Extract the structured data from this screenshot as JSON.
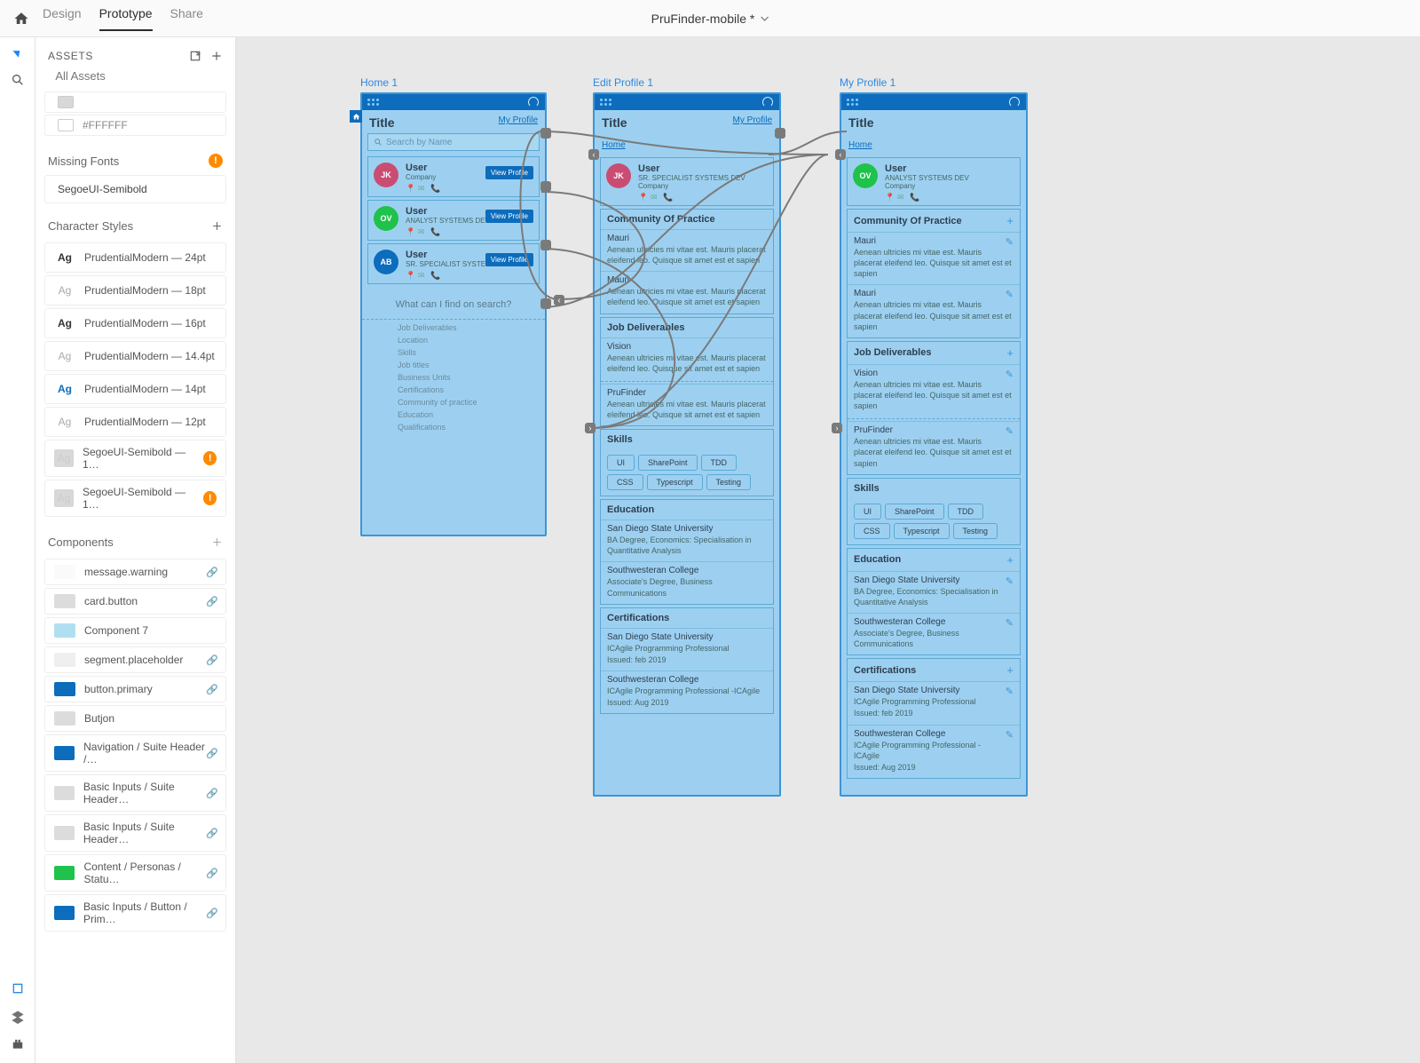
{
  "topbar": {
    "tabs": [
      "Design",
      "Prototype",
      "Share"
    ],
    "project": "PruFinder-mobile *"
  },
  "panel": {
    "assets_label": "ASSETS",
    "search_placeholder": "All Assets",
    "colors": [
      {
        "hex": "#FFFFFF",
        "swatch": "#ffffff"
      }
    ],
    "missing_fonts_label": "Missing Fonts",
    "missing_fonts": [
      "SegoeUI-Semibold"
    ],
    "char_styles_label": "Character Styles",
    "char_styles": [
      {
        "label": "PrudentialModern — 24pt",
        "bold": true,
        "color": "#333"
      },
      {
        "label": "PrudentialModern — 18pt",
        "bold": false,
        "color": "#aaa"
      },
      {
        "label": "PrudentialModern — 16pt",
        "bold": true,
        "color": "#333"
      },
      {
        "label": "PrudentialModern — 14.4pt",
        "bold": false,
        "color": "#aaa"
      },
      {
        "label": "PrudentialModern — 14pt",
        "bold": true,
        "color": "#0d6cbc"
      },
      {
        "label": "PrudentialModern — 12pt",
        "bold": false,
        "color": "#aaa"
      },
      {
        "label": "SegoeUI-Semibold — 1…",
        "bold": false,
        "color": "#ccc",
        "warn": true
      },
      {
        "label": "SegoeUI-Semibold — 1…",
        "bold": false,
        "color": "#ccc",
        "warn": true
      }
    ],
    "components_label": "Components",
    "components": [
      {
        "name": "message.warning",
        "thumb": "#fafafa",
        "link": true
      },
      {
        "name": "card.button",
        "thumb": "#dcdcdc",
        "link": true
      },
      {
        "name": "Component 7",
        "thumb": "#b1dff2"
      },
      {
        "name": "segment.placeholder",
        "thumb": "#efefef",
        "link": true
      },
      {
        "name": "button.primary",
        "thumb": "#0d6cbc",
        "link": true
      },
      {
        "name": "Butjon",
        "thumb": "#dcdcdc"
      },
      {
        "name": "Navigation / Suite Header /…",
        "thumb": "#0d6cbc",
        "link": true
      },
      {
        "name": "Basic Inputs / Suite Header…",
        "thumb": "#dcdcdc",
        "link": true
      },
      {
        "name": "Basic Inputs / Suite Header…",
        "thumb": "#dcdcdc",
        "link": true
      },
      {
        "name": "Content / Personas / Statu…",
        "thumb": "#1fc24a",
        "link": true
      },
      {
        "name": "Basic Inputs / Button / Prim…",
        "thumb": "#0d6cbc",
        "link": true
      }
    ]
  },
  "artboards": {
    "home": {
      "label": "Home 1",
      "title": "Title",
      "profile_link": "My Profile",
      "search_placeholder": "Search by Name",
      "users": [
        {
          "init": "JK",
          "color": "#c94d73",
          "name": "User",
          "role": "Company",
          "btn": "View Profile"
        },
        {
          "init": "OV",
          "color": "#1fc24a",
          "name": "User",
          "role": "ANALYST SYSTEMS DEV",
          "btn": "View Profile"
        },
        {
          "init": "AB",
          "color": "#0d6cbc",
          "name": "User",
          "role": "SR. SPECIALIST SYSTEMS DEV",
          "btn": "View Profile"
        }
      ],
      "hint": "What can I find on search?",
      "hint_items": [
        "Job Deliverables",
        "Location",
        "Skills",
        "Job titles",
        "Business Units",
        "Certifications",
        "Community of practice",
        "Education",
        "Qualifications"
      ]
    },
    "edit": {
      "label": "Edit Profile 1",
      "title": "Title",
      "profile_link": "My Profile",
      "home_link": "Home"
    },
    "my": {
      "label": "My Profile 1",
      "title": "Title",
      "home_link": "Home"
    },
    "profile_user": {
      "init": "OV",
      "color": "#1fc24a",
      "name": "User",
      "role": "ANALYST SYSTEMS DEV",
      "sub": "Company"
    },
    "profile_user_edit": {
      "init": "JK",
      "color": "#c94d73",
      "name": "User",
      "role": "SR. SPECIALIST SYSTEMS DEV",
      "sub": "Company"
    },
    "lorem": "Aenean ultricies mi vitae est. Mauris placerat eleifend leo. Quisque sit amet est et sapien",
    "sections": {
      "cop": {
        "title": "Community Of Practice",
        "items": [
          "Mauri",
          "Mauri"
        ]
      },
      "jd": {
        "title": "Job Deliverables",
        "items": [
          "Vision",
          "PruFinder"
        ]
      },
      "skills": {
        "title": "Skills",
        "chips": [
          "UI",
          "SharePoint",
          "TDD",
          "CSS",
          "Typescript",
          "Testing"
        ]
      },
      "edu": {
        "title": "Education",
        "items": [
          {
            "school": "San Diego State University",
            "deg": "BA Degree, Economics: Specialisation in Quantitative Analysis"
          },
          {
            "school": "Southwesteran College",
            "deg": "Associate's Degree, Business Communications"
          }
        ]
      },
      "cert": {
        "title": "Certifications",
        "items": [
          {
            "school": "San Diego State University",
            "deg": "ICAgile Programming Professional",
            "issued": "Issued: feb 2019"
          },
          {
            "school": "Southwesteran College",
            "deg": "ICAgile Programming Professional -ICAgile",
            "issued": "Issued: Aug 2019"
          }
        ]
      }
    }
  }
}
